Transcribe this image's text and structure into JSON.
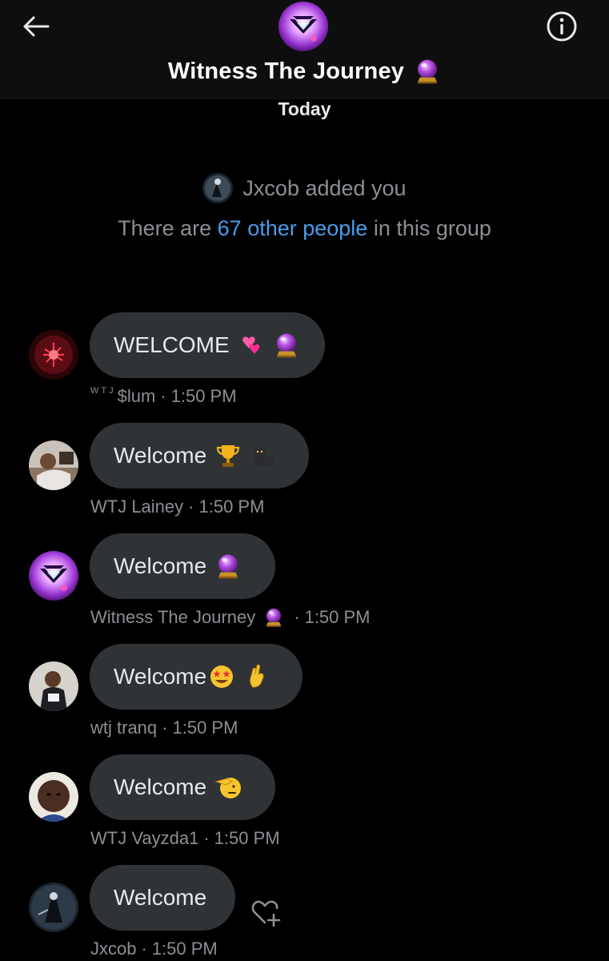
{
  "header": {
    "back_icon": "arrow-left-icon",
    "info_icon": "info-circle-icon",
    "title": "Witness The Journey",
    "title_emoji": "crystal-ball-icon"
  },
  "date_divider": "Today",
  "system": {
    "added_text": "Jxcob added you",
    "count_prefix": "There are ",
    "count_link": "67 other people",
    "count_suffix": " in this group"
  },
  "messages": [
    {
      "text": "WELCOME",
      "emojis": [
        "two-hearts-icon",
        "crystal-ball-icon"
      ],
      "sender_prefix": "WTJ",
      "sender": "$lum",
      "time": "1:50 PM"
    },
    {
      "text": "Welcome",
      "emojis": [
        "trophy-icon",
        "black-cat-icon"
      ],
      "sender": "WTJ Lainey",
      "time": "1:50 PM"
    },
    {
      "text": "Welcome",
      "emojis": [
        "crystal-ball-icon"
      ],
      "sender": "Witness The Journey",
      "sender_emoji": "crystal-ball-icon",
      "time": "1:50 PM"
    },
    {
      "text": "Welcome",
      "emojis": [
        "star-struck-icon",
        "crossed-fingers-icon"
      ],
      "sender": "wtj tranq",
      "time": "1:50 PM"
    },
    {
      "text": "Welcome",
      "emojis": [
        "saluting-face-icon"
      ],
      "sender": "WTJ Vayzda1",
      "time": "1:50 PM"
    },
    {
      "text": "Welcome",
      "emojis": [],
      "sender": "Jxcob",
      "time": "1:50 PM"
    }
  ],
  "react_icon": "heart-plus-icon",
  "colors": {
    "background": "#000000",
    "header_bg": "#0e0e0e",
    "bubble": "#2f3336",
    "muted_text": "#8b8f94",
    "link": "#4a9be8"
  }
}
